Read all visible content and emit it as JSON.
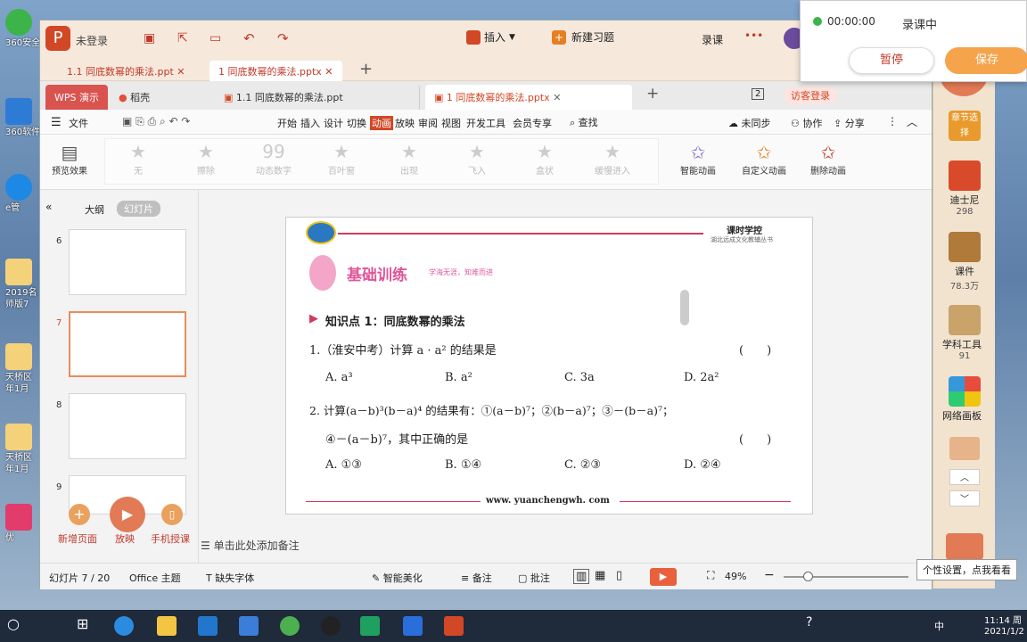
{
  "desktop": {
    "icons": [
      {
        "label": "360安全"
      },
      {
        "label": "360软件"
      },
      {
        "label": "e管"
      },
      {
        "label": "2019名 师版7"
      },
      {
        "label": "天桥区 年1月"
      },
      {
        "label": "天桥区 年1月"
      },
      {
        "label": "优"
      }
    ]
  },
  "titlebar": {
    "login": "未登录",
    "insert": "插入",
    "new_exercise": "新建习题",
    "record": "录课",
    "tabs": [
      "1.1 同底数幂的乘法.ppt",
      "1 同底数幂的乘法.pptx"
    ],
    "add_tab": "+"
  },
  "inner": {
    "tabs": [
      "WPS 演示",
      "稻壳",
      "1.1 同底数幂的乘法.ppt",
      "1 同底数幂的乘法.pptx"
    ],
    "add_tab": "+",
    "page_num": "2",
    "visitor_login": "访客登录"
  },
  "menubar": {
    "file": "文件",
    "items": [
      "开始",
      "插入",
      "设计",
      "切换",
      "动画",
      "放映",
      "审阅",
      "视图",
      "开发工具",
      "会员专享"
    ],
    "active": "动画",
    "search": "查找",
    "sync": "未同步",
    "collab": "协作",
    "share": "分享"
  },
  "ribbon": {
    "preview": "预览效果",
    "effects": [
      "无",
      "擦除",
      "动态数字",
      "百叶窗",
      "出现",
      "飞入",
      "盒状",
      "缓慢进入"
    ],
    "smart": "智能动画",
    "custom": "自定义动画",
    "delete": "删除动画"
  },
  "leftpanel": {
    "outline": "大纲",
    "slides": "幻灯片",
    "slide_numbers": [
      "6",
      "7",
      "8",
      "9"
    ],
    "new_page": "新增页面",
    "play": "放映",
    "phone": "手机授课"
  },
  "slide": {
    "brand": "课时学控",
    "brand_sub": "湖北远成文化教辅丛书",
    "banner": "基础训练",
    "banner_sub": "学海无涯，知难而进",
    "topic": "知识点 1：同底数幂的乘法",
    "q1": "1.（淮安中考）计算 a · a² 的结果是",
    "q1_paren": "(　　)",
    "q1_opts": [
      "A. a³",
      "B. a²",
      "C. 3a",
      "D. 2a²"
    ],
    "q2_line1": "2. 计算(a－b)³(b－a)⁴ 的结果有：①(a－b)⁷；②(b－a)⁷；③－(b－a)⁷；",
    "q2_line2": "④－(a－b)⁷，其中正确的是",
    "q2_paren": "(　　)",
    "q2_opts": [
      "A. ①③",
      "B. ①④",
      "C. ②③",
      "D. ②④"
    ],
    "footer_url": "www. yuanchengwh. com"
  },
  "notes": "单击此处添加备注",
  "statusbar": {
    "slide_info": "幻灯片 7 / 20",
    "theme": "Office 主题",
    "missing_font": "缺失字体",
    "beautify": "智能美化",
    "notes_btn": "备注",
    "comment": "批注",
    "zoom": "49%"
  },
  "rightpanel": {
    "items": [
      {
        "label": "章节选择",
        "count": ""
      },
      {
        "label": "迪士尼",
        "count": "298"
      },
      {
        "label": "课件",
        "count": "78.3万"
      },
      {
        "label": "学科工具",
        "count": "91"
      },
      {
        "label": "网络画板",
        "count": ""
      }
    ]
  },
  "recorder": {
    "time": "00:00:00",
    "status": "录课中",
    "pause": "暂停",
    "save": "保存"
  },
  "tooltip": "个性设置，点我看看",
  "taskbar": {
    "time": "11:14 周",
    "date": "2021/1/2",
    "ime": "中"
  },
  "colors": {
    "accent": "#d24726",
    "active_tab": "#e88c5c",
    "recorder_btn": "#f6a44c"
  }
}
